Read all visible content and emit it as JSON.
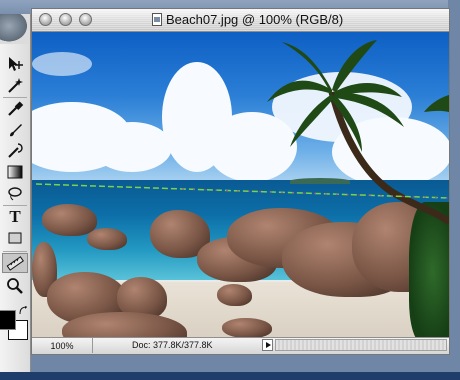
{
  "window": {
    "title": "Beach07.jpg @ 100% (RGB/8)"
  },
  "statusbar": {
    "zoom": "100%",
    "doc_info": "Doc: 377.8K/377.8K"
  },
  "tools": [
    {
      "name": "move-tool-icon"
    },
    {
      "name": "magic-wand-icon"
    },
    {
      "name": "eyedropper-icon"
    },
    {
      "name": "brush-icon"
    },
    {
      "name": "history-brush-icon"
    },
    {
      "name": "gradient-icon"
    },
    {
      "name": "lasso-icon"
    },
    {
      "name": "type-tool-icon",
      "glyph": "T"
    },
    {
      "name": "rectangle-tool-icon"
    },
    {
      "name": "measure-tool-icon"
    },
    {
      "name": "zoom-tool-icon"
    }
  ],
  "colors": {
    "foreground": "#000000",
    "background": "#ffffff",
    "measure_line_start": "#7bd34a",
    "measure_line_end": "#c23a9a"
  }
}
